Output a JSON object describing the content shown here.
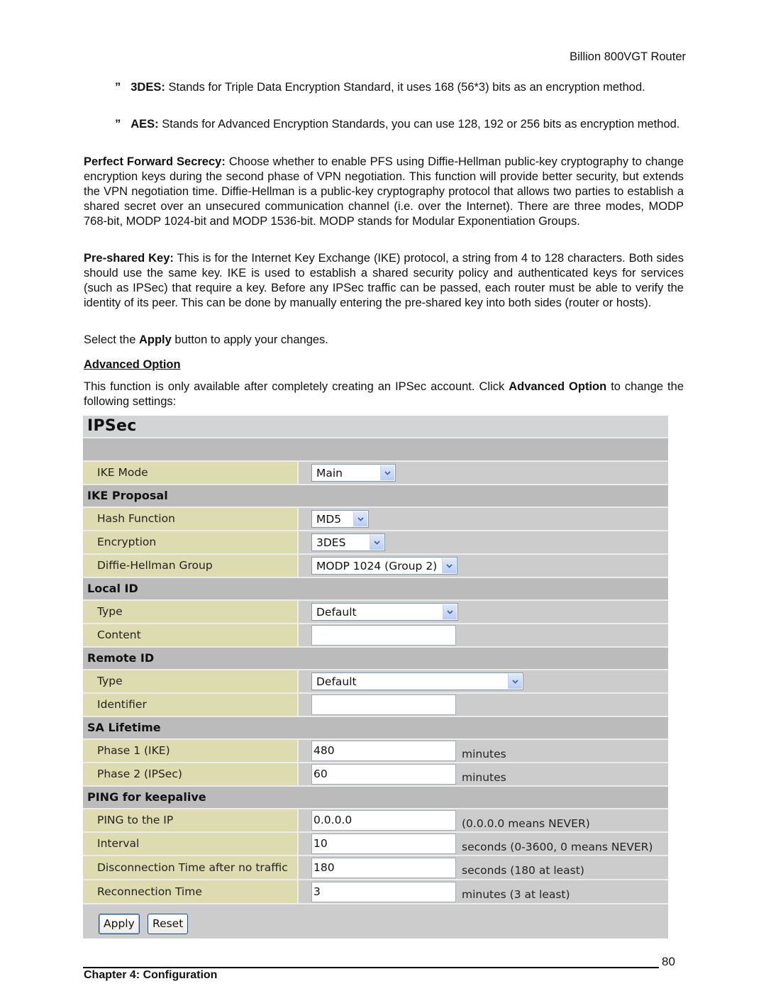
{
  "header": {
    "title": "Billion 800VGT Router"
  },
  "bullets": [
    {
      "mark": "”",
      "term": "3DES:",
      "text": " Stands for Triple Data Encryption Standard, it uses 168 (56*3) bits as an encryption method."
    },
    {
      "mark": "”",
      "term": "AES:",
      "text": " Stands for Advanced Encryption Standards, you can use 128, 192 or 256 bits as encryption method."
    }
  ],
  "paragraphs": {
    "pfs": {
      "term": "Perfect Forward Secrecy:",
      "text": " Choose whether to enable PFS using Diffie-Hellman public-key cryptography to change encryption keys during the second phase of VPN negotiation. This function will provide better security, but extends the VPN negotiation time. Diffie-Hellman is a public-key cryptography protocol that allows two parties to establish a shared secret over an unsecured communication channel (i.e. over the Internet). There are three modes, MODP 768-bit, MODP 1024-bit and MODP 1536-bit. MODP stands for Modular Exponentiation Groups."
    },
    "psk": {
      "term": "Pre-shared Key:",
      "text": " This is for the Internet Key Exchange (IKE) protocol, a string from 4 to 128 characters. Both sides should use the same key. IKE is used to establish a shared security policy and authenticated keys for services (such as IPSec) that require a key. Before any IPSec traffic can be passed, each router must be able to verify the identity of its peer. This can be done by manually entering the pre-shared key into both sides (router or hosts)."
    },
    "apply": {
      "before": "Select the ",
      "bold": "Apply",
      "after": " button to apply your changes."
    },
    "advanced": {
      "before": "This function is only available after completely creating an IPSec account. Click ",
      "bold": "Advanced Option",
      "after": " to change the following settings:"
    }
  },
  "section_title": "Advanced Option",
  "ipsec": {
    "title": "IPSec",
    "ike_mode": {
      "label": "IKE Mode",
      "value": "Main"
    },
    "ike_proposal": {
      "heading": "IKE Proposal",
      "hash": {
        "label": "Hash Function",
        "value": "MD5"
      },
      "encryption": {
        "label": "Encryption",
        "value": "3DES"
      },
      "dh_group": {
        "label": "Diffie-Hellman Group",
        "value": "MODP 1024 (Group 2)"
      }
    },
    "local_id": {
      "heading": "Local ID",
      "type": {
        "label": "Type",
        "value": "Default"
      },
      "content": {
        "label": "Content",
        "value": ""
      }
    },
    "remote_id": {
      "heading": "Remote ID",
      "type": {
        "label": "Type",
        "value": "Default"
      },
      "identifier": {
        "label": "Identifier",
        "value": ""
      }
    },
    "sa_lifetime": {
      "heading": "SA Lifetime",
      "phase1": {
        "label": "Phase 1 (IKE)",
        "value": "480",
        "unit": "minutes"
      },
      "phase2": {
        "label": "Phase 2 (IPSec)",
        "value": "60",
        "unit": "minutes"
      }
    },
    "ping": {
      "heading": "PING for keepalive",
      "ip": {
        "label": "PING to the IP",
        "value": "0.0.0.0",
        "hint": "(0.0.0.0 means NEVER)"
      },
      "interval": {
        "label": "Interval",
        "value": "10",
        "hint": "seconds (0-3600, 0 means NEVER)"
      },
      "disconnect": {
        "label": "Disconnection Time after no traffic",
        "value": "180",
        "hint": "seconds (180 at least)"
      },
      "reconnect": {
        "label": "Reconnection Time",
        "value": "3",
        "hint": "minutes (3 at least)"
      }
    },
    "buttons": {
      "apply": "Apply",
      "reset": "Reset"
    }
  },
  "footer": {
    "chapter": "Chapter 4: Configuration",
    "page_number": "80"
  }
}
